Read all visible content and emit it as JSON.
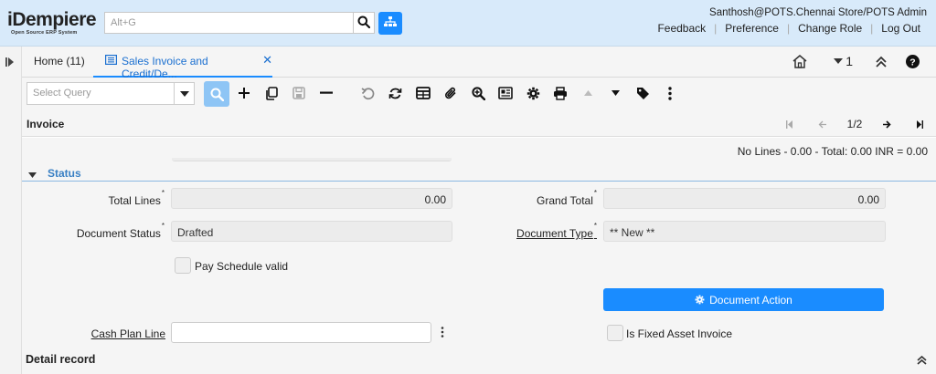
{
  "header": {
    "logo_main": "iDempiere",
    "logo_sub": "Open Source ERP System",
    "search_placeholder": "Alt+G",
    "user_info": "Santhosh@POTS.Chennai Store/POTS Admin",
    "links": [
      "Feedback",
      "Preference",
      "Change Role",
      "Log Out"
    ]
  },
  "tabs": {
    "home_label": "Home (11)",
    "active_label": "Sales Invoice and Credit/De...",
    "window_count": "1"
  },
  "toolbar": {
    "query_placeholder": "Select Query"
  },
  "statusbar": {
    "title": "Invoice",
    "record_position": "1/2"
  },
  "summary": "No Lines - 0.00 - Total: 0.00 INR = 0.00",
  "status_group": {
    "label": "Status",
    "total_lines_label": "Total Lines",
    "total_lines_value": "0.00",
    "grand_total_label": "Grand Total",
    "grand_total_value": "0.00",
    "document_status_label": "Document Status",
    "document_status_value": "Drafted",
    "document_type_label": "Document Type",
    "document_type_value": "** New **",
    "pay_schedule_label": "Pay Schedule valid",
    "document_action_label": "Document Action",
    "cash_plan_line_label": "Cash Plan Line",
    "cash_plan_line_value": "",
    "fixed_asset_label": "Is Fixed Asset Invoice"
  },
  "detail": {
    "title": "Detail record"
  },
  "colors": {
    "header_bg": "#d8eafa",
    "accent": "#1a8cff",
    "group_label": "#3a80c4"
  }
}
